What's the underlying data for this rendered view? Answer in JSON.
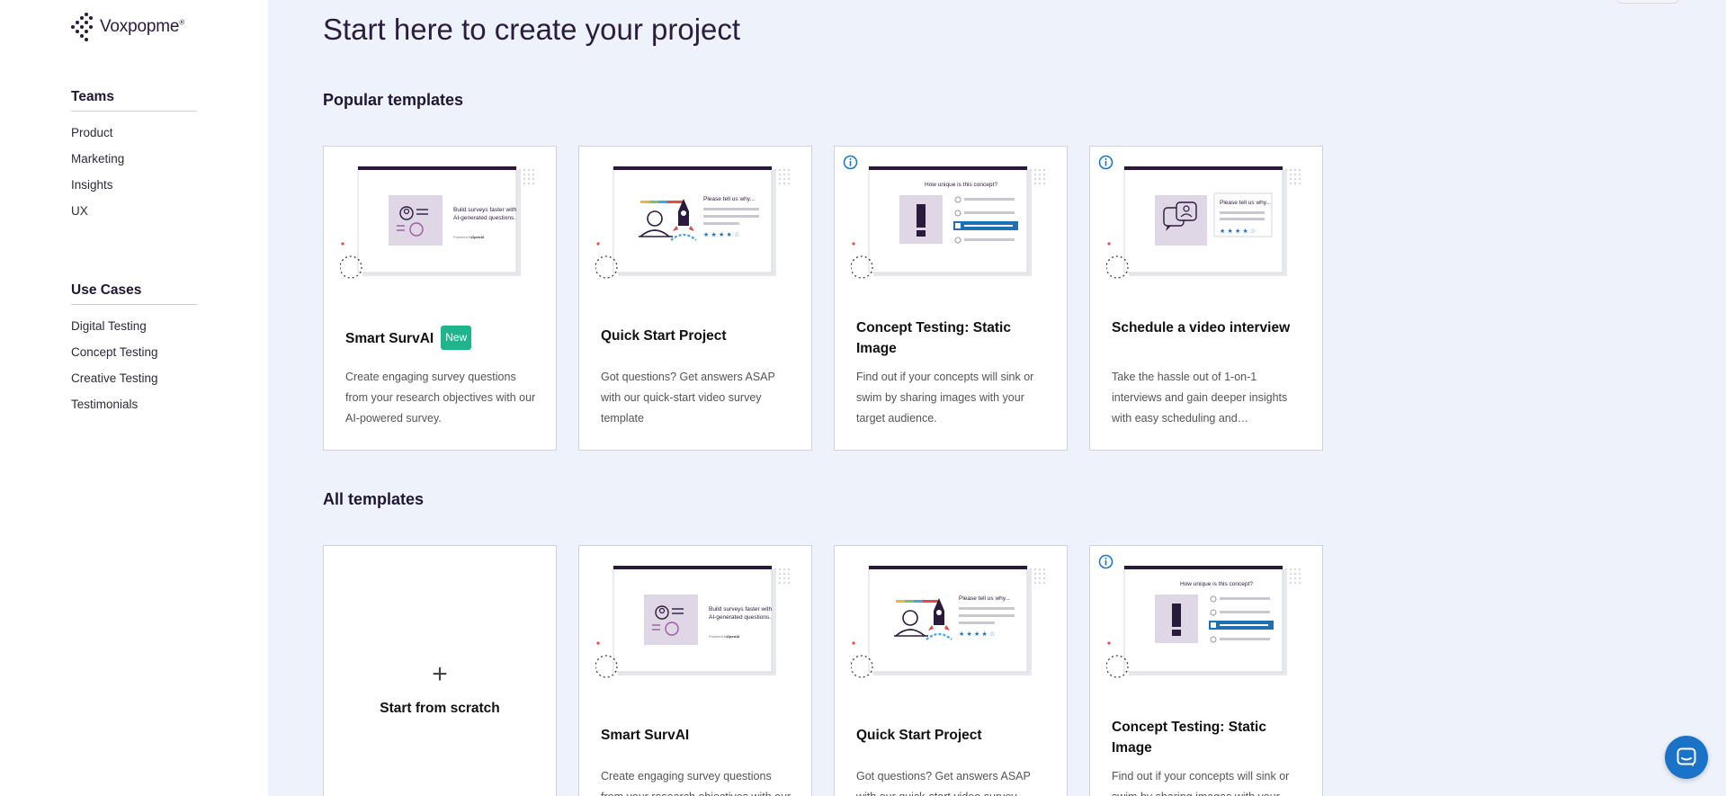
{
  "brand": {
    "name": "Voxpopme",
    "mark": "®"
  },
  "sidebar": {
    "sections": [
      {
        "heading": "Teams",
        "items": [
          "Product",
          "Marketing",
          "Insights",
          "UX"
        ]
      },
      {
        "heading": "Use Cases",
        "items": [
          "Digital Testing",
          "Concept Testing",
          "Creative Testing",
          "Testimonials"
        ]
      }
    ]
  },
  "main": {
    "title": "Start here to create your project",
    "popular_heading": "Popular templates",
    "all_heading": "All templates",
    "popular": [
      {
        "title": "Smart SurvAI",
        "badge": "New",
        "desc": "Create engaging survey questions from your research objectives with our AI-powered survey.",
        "thumb": "ai",
        "info": false
      },
      {
        "title": "Quick Start Project",
        "desc": "Got questions? Get answers ASAP with our quick-start video survey template",
        "thumb": "rocket",
        "info": false
      },
      {
        "title": "Concept Testing: Static Image",
        "desc": "Find out if your concepts will sink or swim by sharing images with your target audience.",
        "thumb": "concept",
        "info": true
      },
      {
        "title": "Schedule a video interview",
        "desc": "Take the hassle out of 1-on-1 interviews and gain deeper insights with easy scheduling and…",
        "thumb": "interview",
        "info": true
      }
    ],
    "all": [
      {
        "scratch": true,
        "plus": "+",
        "title": "Start from scratch"
      },
      {
        "title": "Smart SurvAI",
        "desc": "Create engaging survey questions from your research objectives with our AI-powered survey.",
        "thumb": "ai",
        "info": false
      },
      {
        "title": "Quick Start Project",
        "desc": "Got questions? Get answers ASAP with our quick-start video survey template",
        "thumb": "rocket",
        "info": false
      },
      {
        "title": "Concept Testing: Static Image",
        "desc": "Find out if your concepts will sink or swim by sharing images with your target audience.",
        "thumb": "concept",
        "info": true
      }
    ],
    "thumb_text": {
      "ai_line1": "Build surveys faster with",
      "ai_line2": "AI-generated questions.",
      "ai_powered": "Powered by",
      "ai_vendor": "OpenAI",
      "rocket": "Please tell us why...",
      "concept": "How unique is this concept?",
      "interview": "Please tell us why..."
    }
  },
  "colors": {
    "accent": "#1a73c7",
    "badge": "#1fb58c",
    "ink": "#2a1b3d",
    "thumb_bg": "#e0d7e6",
    "highlight": "#1f6fb5"
  }
}
